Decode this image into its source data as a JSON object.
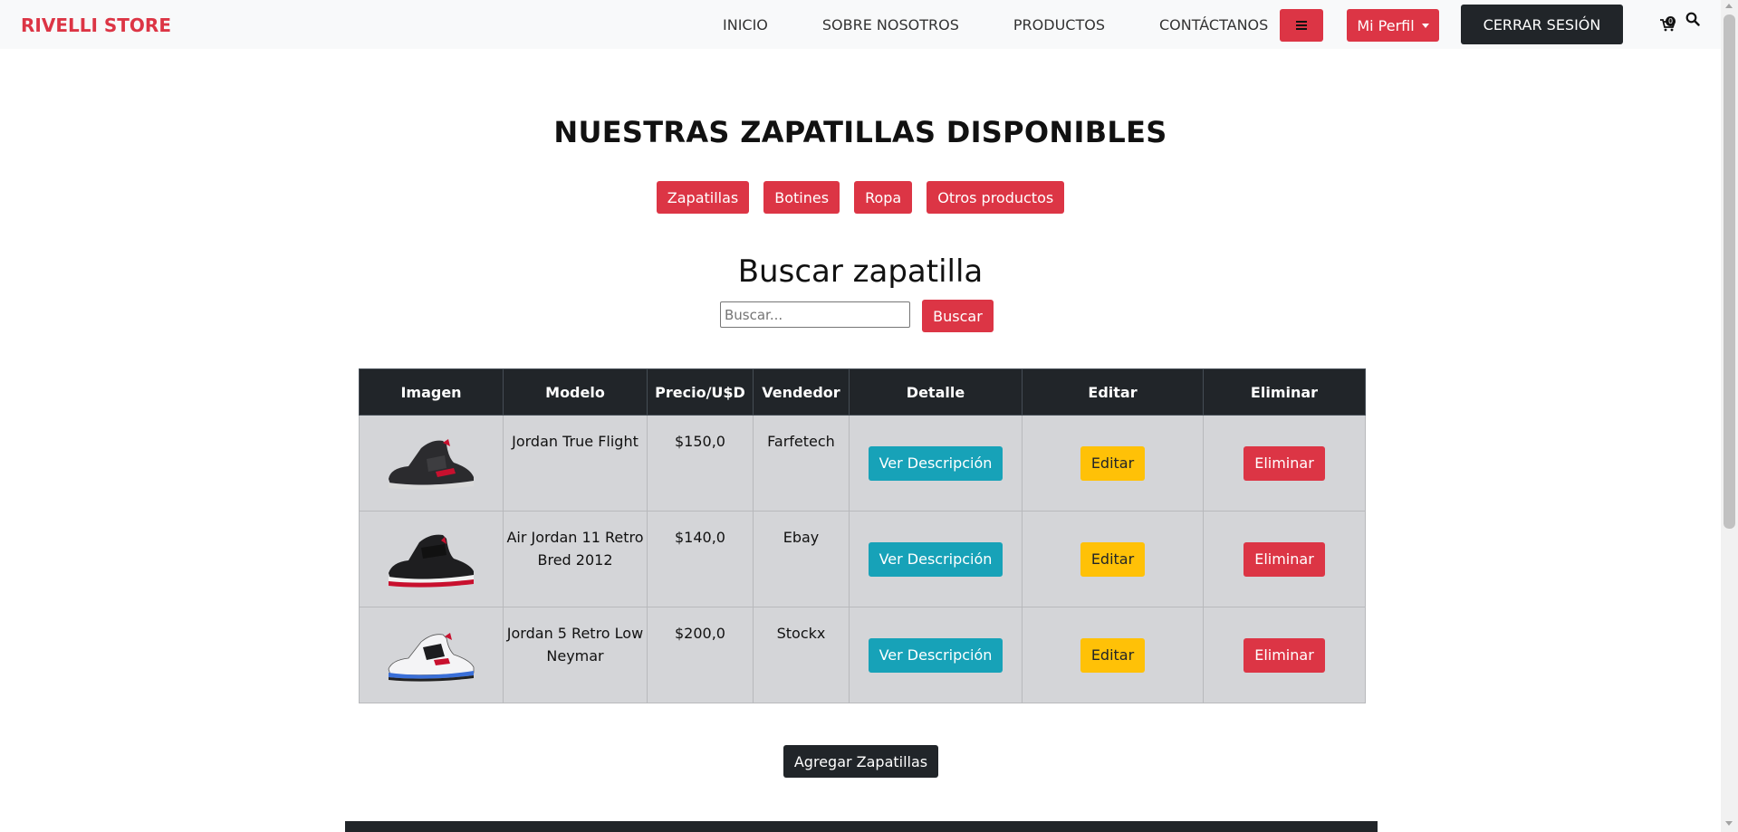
{
  "brand": "RIVELLI STORE",
  "nav": {
    "links": [
      "INICIO",
      "SOBRE NOSOTROS",
      "PRODUCTOS",
      "CONTÁCTANOS"
    ],
    "profile_label": "Mi Perfil",
    "logout_label": "CERRAR SESIÓN",
    "cart_count": "0"
  },
  "page_title": "NUESTRAS ZAPATILLAS DISPONIBLES",
  "categories": [
    "Zapatillas",
    "Botines",
    "Ropa",
    "Otros productos"
  ],
  "search": {
    "title": "Buscar zapatilla",
    "placeholder": "Buscar...",
    "button_label": "Buscar"
  },
  "table": {
    "headers": [
      "Imagen",
      "Modelo",
      "Precio/U$D",
      "Vendedor",
      "Detalle",
      "Editar",
      "Eliminar"
    ],
    "rows": [
      {
        "model": "Jordan True Flight",
        "price": "$150,0",
        "seller": "Farfetech",
        "detail": "Ver Descripción",
        "edit": "Editar",
        "delete": "Eliminar"
      },
      {
        "model": "Air Jordan 11 Retro Bred 2012",
        "price": "$140,0",
        "seller": "Ebay",
        "detail": "Ver Descripción",
        "edit": "Editar",
        "delete": "Eliminar"
      },
      {
        "model": "Jordan 5 Retro Low Neymar",
        "price": "$200,0",
        "seller": "Stockx",
        "detail": "Ver Descripción",
        "edit": "Editar",
        "delete": "Eliminar"
      }
    ]
  },
  "add_button_label": "Agregar Zapatillas",
  "colors": {
    "brand_red": "#dc3545",
    "dark": "#212529",
    "info": "#17a2b8",
    "warning": "#ffc107"
  }
}
